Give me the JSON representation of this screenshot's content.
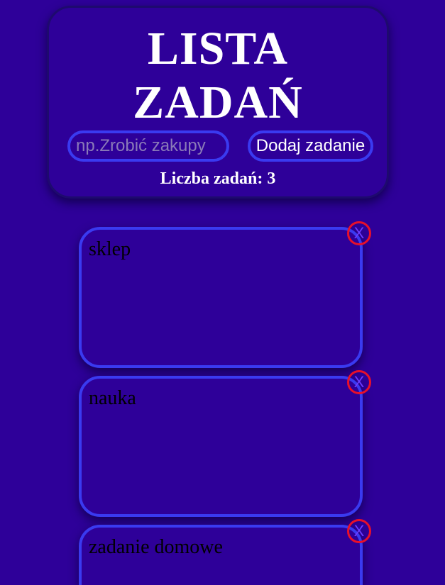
{
  "header": {
    "title_line1": "LISTA",
    "title_line2": "ZADAŃ",
    "input_placeholder": "np.Zrobić zakupy",
    "add_button_label": "Dodaj zadanie",
    "count_label": "Liczba zadań: 3"
  },
  "tasks": [
    {
      "text": "sklep",
      "delete_label": "X"
    },
    {
      "text": "nauka",
      "delete_label": "X"
    },
    {
      "text": "zadanie domowe",
      "delete_label": "X"
    }
  ],
  "colors": {
    "background": "#2e0099",
    "accent_border": "#3a3af0",
    "delete_red": "#e8102a",
    "text_white": "#ffffff"
  }
}
